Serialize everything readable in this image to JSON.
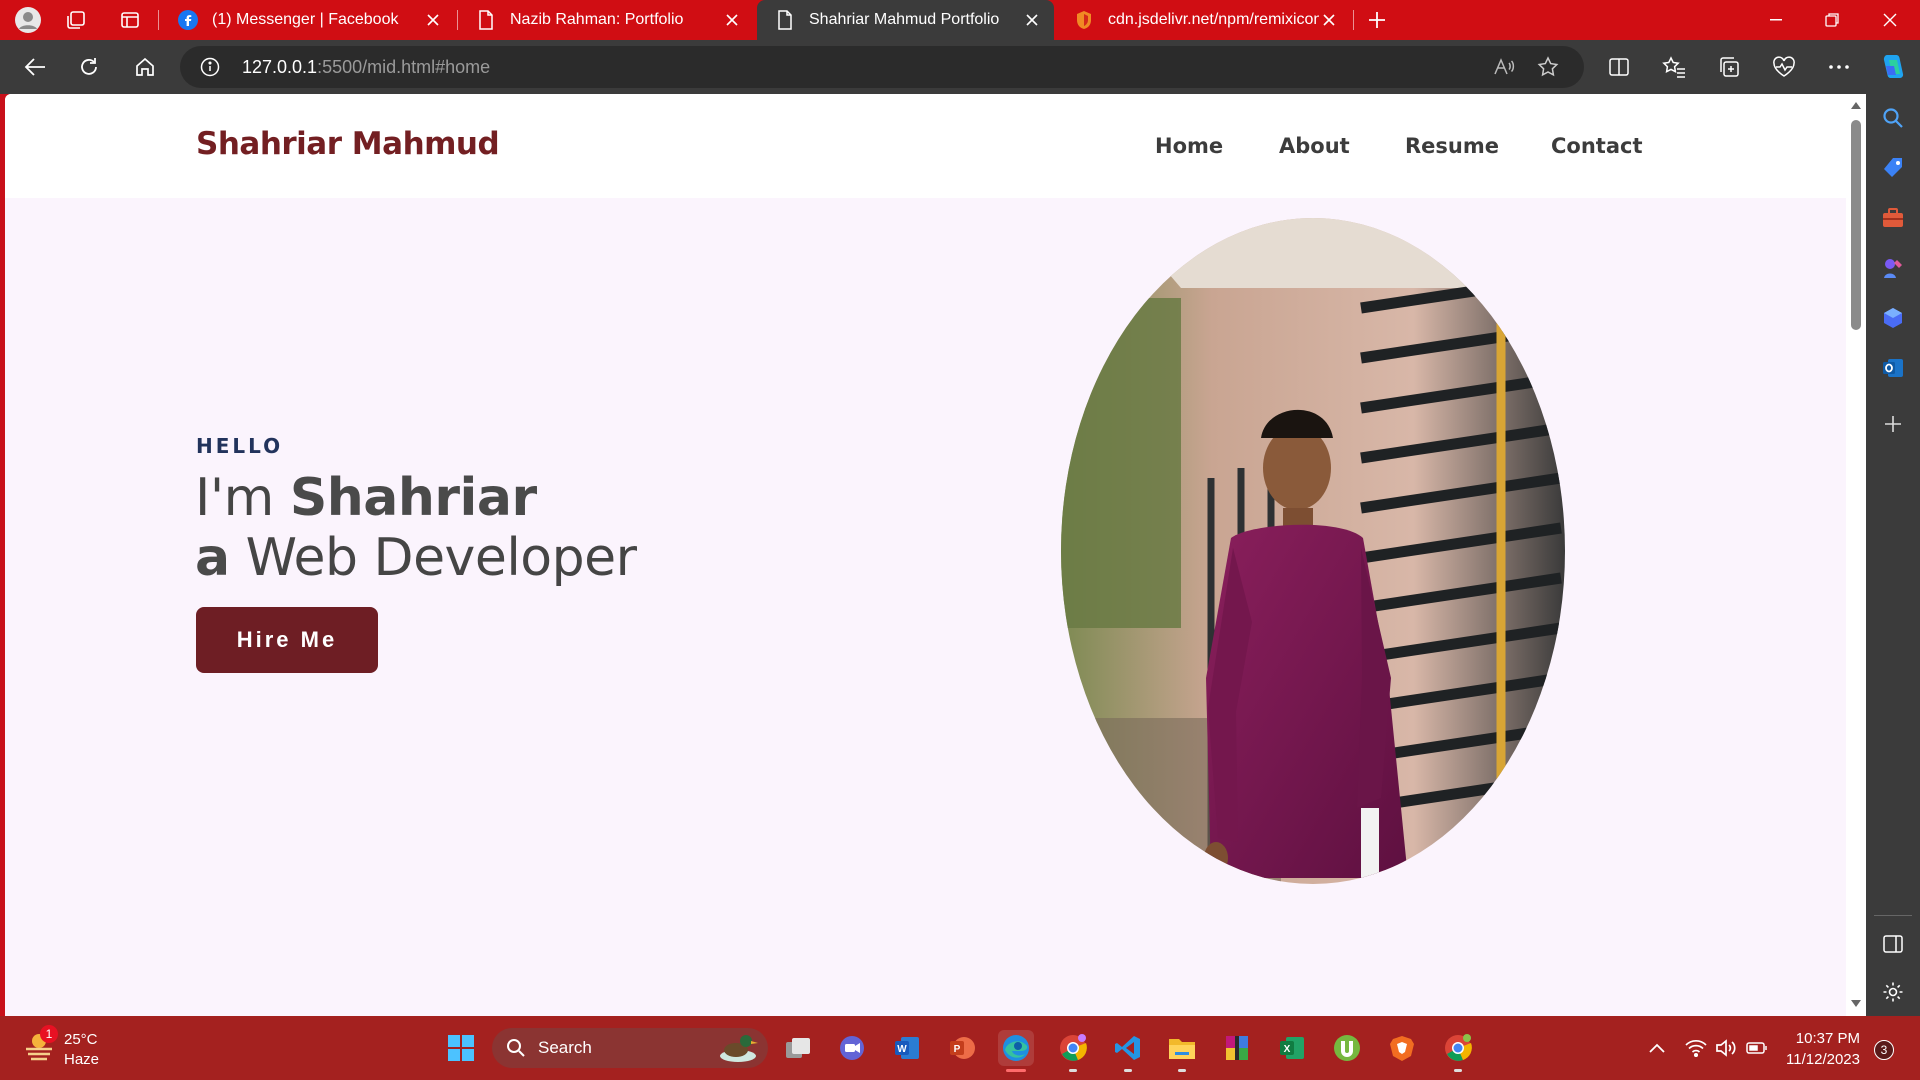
{
  "browser": {
    "tabs": [
      {
        "title": "(1) Messenger | Facebook",
        "icon": "facebook-icon"
      },
      {
        "title": "Nazib Rahman: Portfolio",
        "icon": "page-icon"
      },
      {
        "title": "Shahriar Mahmud Portfolio",
        "icon": "page-icon",
        "active": true
      },
      {
        "title": "cdn.jsdelivr.net/npm/remixicon@",
        "icon": "shield-icon"
      }
    ],
    "address": {
      "host": "127.0.0.1",
      "path": ":5500/mid.html#home"
    }
  },
  "site": {
    "brand": "Shahriar Mahmud",
    "nav": [
      "Home",
      "About",
      "Resume",
      "Contact"
    ],
    "hero": {
      "greeting": "HELLO",
      "line1_prefix": "I'm ",
      "line1_name": "Shahriar",
      "line2_prefix": "a",
      "line2_rest": " Web Developer",
      "cta": "Hire Me"
    },
    "colors": {
      "brand": "#731f22",
      "button": "#6e1e24",
      "hero_bg": "#fbf4fd",
      "greeting": "#22335c"
    }
  },
  "taskbar": {
    "weather": {
      "temp": "25°C",
      "condition": "Haze",
      "badge": "1"
    },
    "search_label": "Search",
    "clock": {
      "time": "10:37 PM",
      "date": "11/12/2023"
    },
    "notifications": "3"
  }
}
